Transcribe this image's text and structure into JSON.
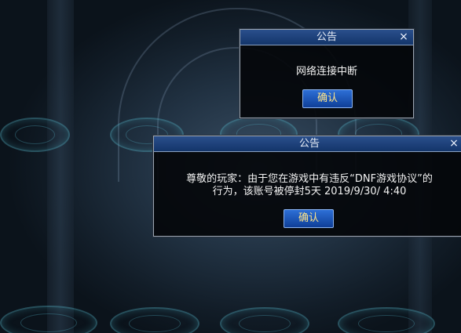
{
  "dialog_network": {
    "title": "公告",
    "close_symbol": "×",
    "message": "网络连接中断",
    "confirm_label": "确认"
  },
  "dialog_ban": {
    "title": "公告",
    "close_symbol": "×",
    "message_line1": "尊敬的玩家：由于您在游戏中有违反“DNF游戏协议”的",
    "message_line2": "行为，该账号被停封5天 2019/9/30/ 4:40",
    "confirm_label": "确认"
  },
  "colors": {
    "titlebar": "#1f4786",
    "button_text": "#ffe58a",
    "button_bg": "#1d56b7"
  }
}
